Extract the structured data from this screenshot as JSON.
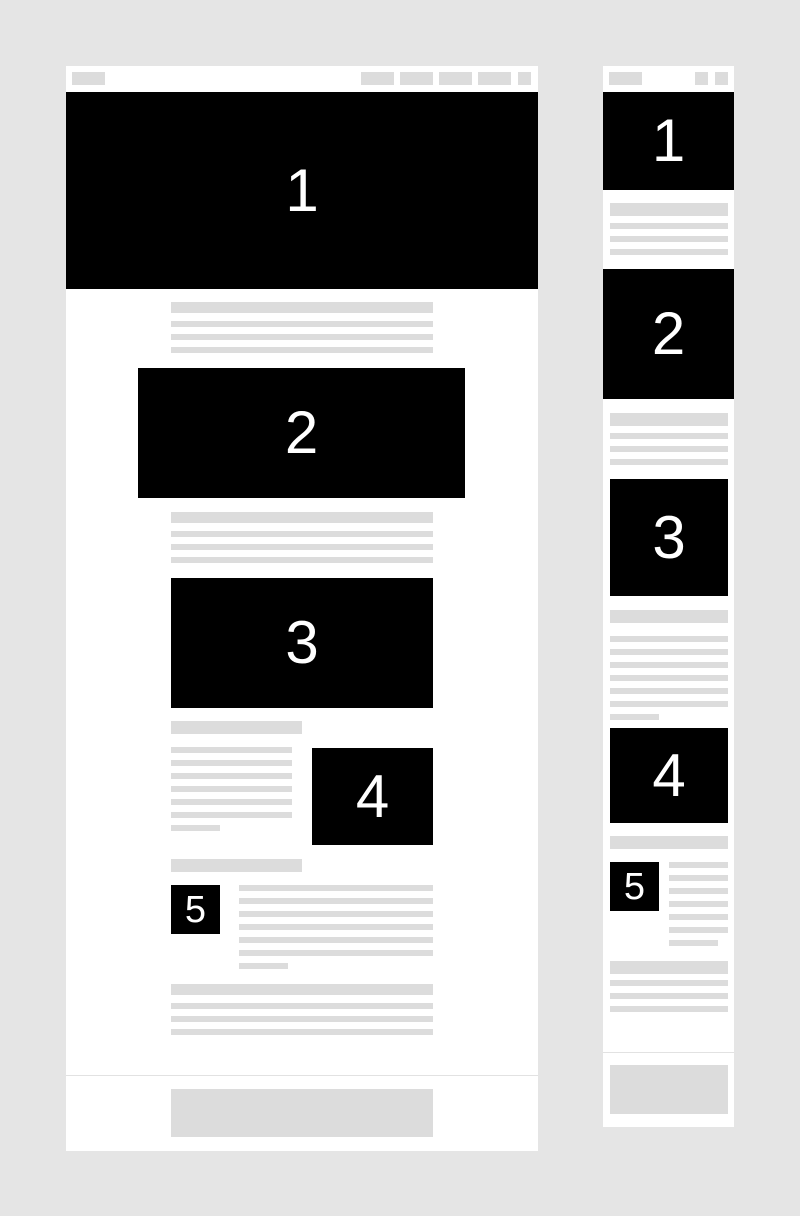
{
  "colors": {
    "background": "#e5e5e5",
    "frame": "#ffffff",
    "placeholder": "#dcdcdc",
    "block": "#000000",
    "block_text": "#ffffff"
  },
  "desktop": {
    "nav_item_count": 5,
    "blocks": [
      "1",
      "2",
      "3",
      "4",
      "5"
    ]
  },
  "mobile": {
    "nav_item_count": 2,
    "blocks": [
      "1",
      "2",
      "3",
      "4",
      "5"
    ]
  }
}
